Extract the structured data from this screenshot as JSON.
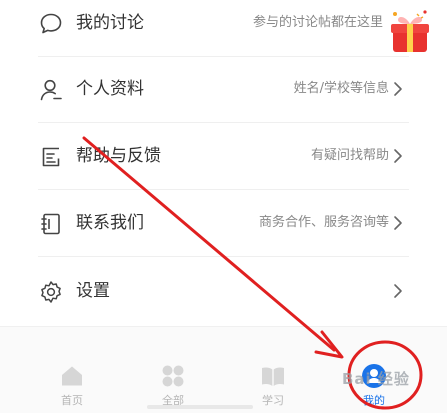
{
  "menu": {
    "items": [
      {
        "label": "我的讨论",
        "hint": "参与的讨论帖都在这里",
        "icon": "chat-bubble-icon"
      },
      {
        "label": "个人资料",
        "hint": "姓名/学校等信息",
        "icon": "person-icon"
      },
      {
        "label": "帮助与反馈",
        "hint": "有疑问找帮助",
        "icon": "feedback-icon"
      },
      {
        "label": "联系我们",
        "hint": "商务合作、服务咨询等",
        "icon": "contact-book-icon"
      },
      {
        "label": "设置",
        "hint": "",
        "icon": "gear-icon"
      }
    ]
  },
  "tabbar": {
    "tabs": [
      {
        "label": "首页",
        "icon": "home-icon"
      },
      {
        "label": "全部",
        "icon": "grid-icon"
      },
      {
        "label": "学习",
        "icon": "book-icon"
      },
      {
        "label": "我的",
        "icon": "profile-icon",
        "active": true
      }
    ]
  },
  "watermark": "Bai 经验",
  "colors": {
    "accent": "#1a73e8",
    "annotation_red": "#e02020",
    "text": "#333333",
    "hint": "#888888"
  }
}
